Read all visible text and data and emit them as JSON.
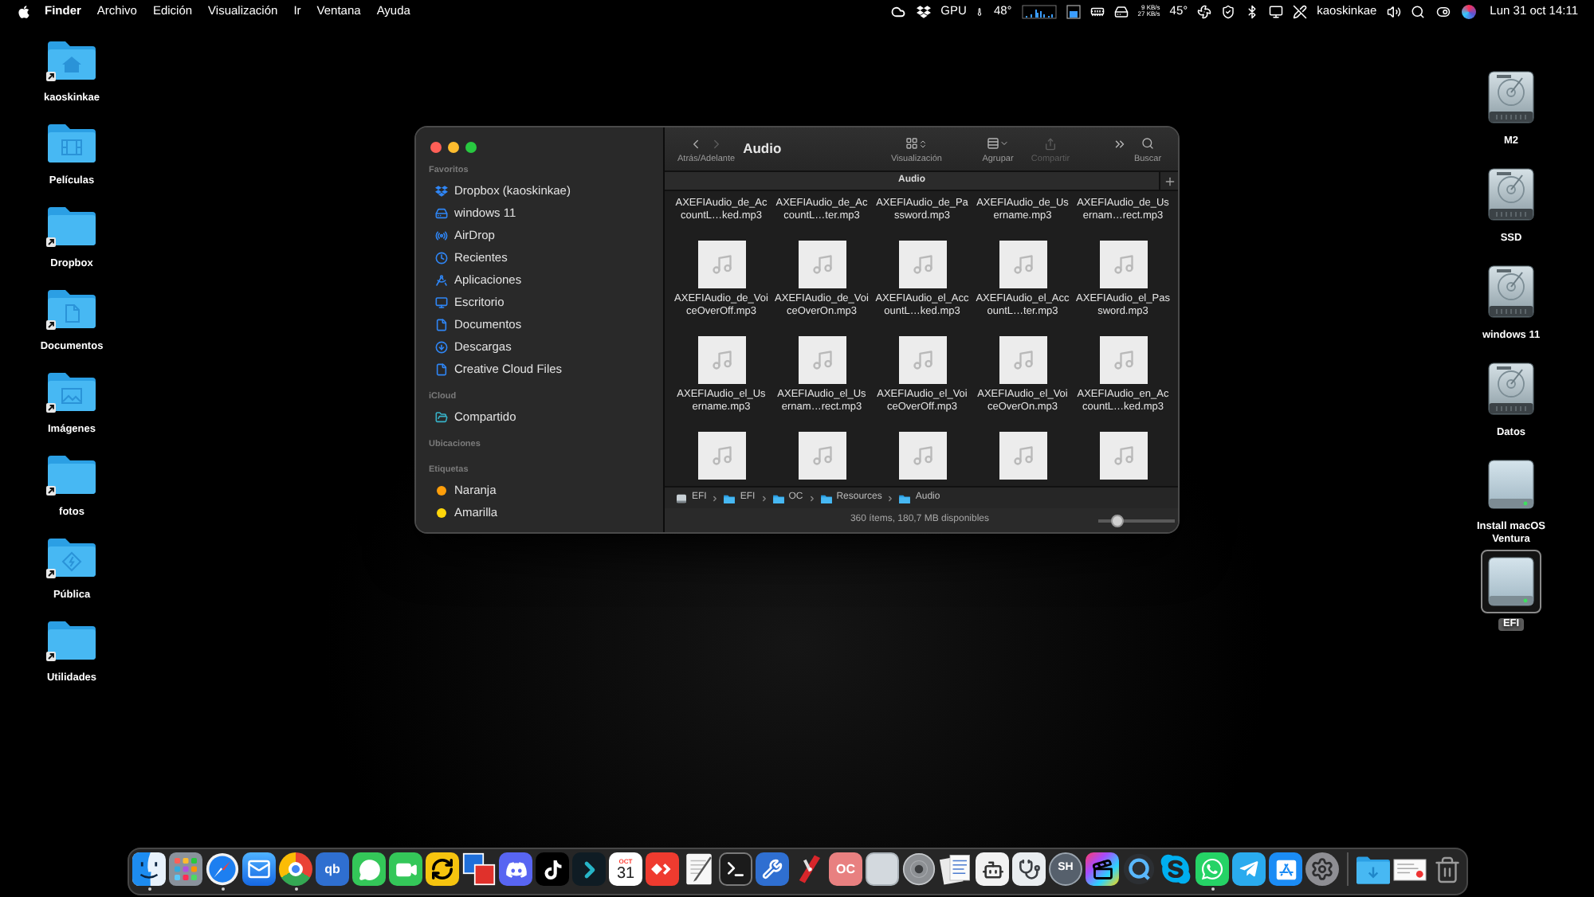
{
  "menu_bar": {
    "app": "Finder",
    "menus": [
      "Archivo",
      "Edición",
      "Visualización",
      "Ir",
      "Ventana",
      "Ayuda"
    ],
    "status": {
      "gpu_label": "GPU",
      "gpu_temp": "48°",
      "net_up": "9 KB/s",
      "net_down": "27 KB/s",
      "cpu_temp": "45°",
      "user": "kaoskinkae",
      "clock": "Lun 31 oct 14:11"
    }
  },
  "desktop_left": [
    {
      "label": "kaoskinkae",
      "kind": "home",
      "alias": true
    },
    {
      "label": "Películas",
      "kind": "film",
      "alias": false
    },
    {
      "label": "Dropbox",
      "kind": "plain",
      "alias": true
    },
    {
      "label": "Documentos",
      "kind": "document",
      "alias": true
    },
    {
      "label": "Imágenes",
      "kind": "image",
      "alias": true
    },
    {
      "label": "fotos",
      "kind": "plain",
      "alias": true
    },
    {
      "label": "Pública",
      "kind": "public",
      "alias": true
    },
    {
      "label": "Utilidades",
      "kind": "plain",
      "alias": true
    }
  ],
  "desktop_right": [
    {
      "label": "M2",
      "kind": "internal",
      "selected": false
    },
    {
      "label": "SSD",
      "kind": "internal",
      "selected": false
    },
    {
      "label": "windows 11",
      "kind": "internal",
      "selected": false
    },
    {
      "label": "Datos",
      "kind": "internal",
      "selected": false
    },
    {
      "label": "Install macOS Ventura",
      "kind": "external",
      "selected": false
    },
    {
      "label": "EFI",
      "kind": "external",
      "selected": true
    }
  ],
  "finder": {
    "sidebar": [
      {
        "title": "Favoritos",
        "items": [
          {
            "label": "Dropbox (kaoskinkae)",
            "kind": "dropbox"
          },
          {
            "label": "windows 11",
            "kind": "drive"
          },
          {
            "label": "AirDrop",
            "kind": "airdrop"
          },
          {
            "label": "Recientes",
            "kind": "recents"
          },
          {
            "label": "Aplicaciones",
            "kind": "apps"
          },
          {
            "label": "Escritorio",
            "kind": "desktop"
          },
          {
            "label": "Documentos",
            "kind": "document"
          },
          {
            "label": "Descargas",
            "kind": "downloads"
          },
          {
            "label": "Creative Cloud Files",
            "kind": "document"
          }
        ]
      },
      {
        "title": "iCloud",
        "items": [
          {
            "label": "Compartido",
            "kind": "shared"
          }
        ]
      },
      {
        "title": "Ubicaciones"
      },
      {
        "title": "Etiquetas",
        "items": [
          {
            "label": "Naranja",
            "kind": "tag",
            "color": "#ff9f0a"
          },
          {
            "label": "Amarilla",
            "kind": "tag",
            "color": "#ffd60a"
          }
        ]
      }
    ],
    "toolbar": {
      "nav": {
        "label": "Atrás/Adelante",
        "back_disabled": false,
        "forward_disabled": true
      },
      "title": "Audio",
      "buttons": [
        {
          "kind": "view",
          "label": "Visualización",
          "disabled": false
        },
        {
          "kind": "group",
          "label": "Agrupar",
          "disabled": false
        },
        {
          "kind": "share",
          "label": "Compartir",
          "disabled": true
        },
        {
          "kind": "more",
          "disabled": false
        },
        {
          "kind": "search",
          "label": "Buscar",
          "disabled": false
        }
      ]
    },
    "tabs": [
      {
        "label": "Audio",
        "selected": true
      }
    ],
    "files": [
      {
        "name": "AXEFIAudio_de_AccountL…ked.mp3",
        "thumbnail": false
      },
      {
        "name": "AXEFIAudio_de_AccountL…ter.mp3",
        "thumbnail": false
      },
      {
        "name": "AXEFIAudio_de_Password.mp3",
        "thumbnail": false
      },
      {
        "name": "AXEFIAudio_de_Username.mp3",
        "thumbnail": false
      },
      {
        "name": "AXEFIAudio_de_Usernam…rect.mp3",
        "thumbnail": false
      },
      {
        "name": "AXEFIAudio_de_VoiceOverOff.mp3",
        "thumbnail": true
      },
      {
        "name": "AXEFIAudio_de_VoiceOverOn.mp3",
        "thumbnail": true
      },
      {
        "name": "AXEFIAudio_el_AccountL…ked.mp3",
        "thumbnail": true
      },
      {
        "name": "AXEFIAudio_el_AccountL…ter.mp3",
        "thumbnail": true
      },
      {
        "name": "AXEFIAudio_el_Password.mp3",
        "thumbnail": true
      },
      {
        "name": "AXEFIAudio_el_Username.mp3",
        "thumbnail": true
      },
      {
        "name": "AXEFIAudio_el_Usernam…rect.mp3",
        "thumbnail": true
      },
      {
        "name": "AXEFIAudio_el_VoiceOverOff.mp3",
        "thumbnail": true
      },
      {
        "name": "AXEFIAudio_el_VoiceOverOn.mp3",
        "thumbnail": true
      },
      {
        "name": "AXEFIAudio_en_AccountL…ked.mp3",
        "thumbnail": true
      },
      {
        "thumbnail": true
      },
      {
        "thumbnail": true
      },
      {
        "thumbnail": true
      },
      {
        "thumbnail": true
      },
      {
        "thumbnail": true
      }
    ],
    "path": [
      {
        "label": "EFI",
        "kind": "disk"
      },
      {
        "label": "EFI",
        "kind": "folder"
      },
      {
        "label": "OC",
        "kind": "folder"
      },
      {
        "label": "Resources",
        "kind": "folder"
      },
      {
        "label": "Audio",
        "kind": "folder"
      }
    ],
    "status": "360 ítems, 180,7 MB disponibles",
    "icon_size": {
      "level": 0.25
    }
  },
  "dock": {
    "apps": [
      {
        "kind": "face",
        "running": true
      },
      {
        "kind": "app_grid",
        "running": false
      },
      {
        "kind": "compass",
        "running": true
      },
      {
        "kind": "envelope",
        "running": false
      },
      {
        "kind": "tricolor",
        "running": true
      },
      {
        "kind": "letter_tile",
        "label": "qb",
        "color": "#2f6fd0",
        "running": false
      },
      {
        "kind": "chat_bubble",
        "running": false
      },
      {
        "kind": "video_camera",
        "running": false
      },
      {
        "kind": "sync_arrows",
        "running": false
      },
      {
        "kind": "overlapping_squares",
        "running": false
      },
      {
        "kind": "controller",
        "running": false
      },
      {
        "kind": "music_note",
        "running": false
      },
      {
        "kind": "chevron",
        "running": false
      },
      {
        "kind": "calendar",
        "month": "OCT",
        "day": "31",
        "running": false
      },
      {
        "kind": "diamonds",
        "running": false
      },
      {
        "kind": "paper_pen",
        "running": false
      },
      {
        "kind": "terminal",
        "running": false
      },
      {
        "kind": "tools",
        "running": false
      },
      {
        "kind": "knife",
        "running": false
      },
      {
        "kind": "letter_tile",
        "label": "OC",
        "color": "#e88080",
        "running": false
      },
      {
        "kind": "blank_tile",
        "running": false
      },
      {
        "kind": "disc",
        "running": false
      },
      {
        "kind": "documents",
        "running": false
      },
      {
        "kind": "robot",
        "running": false
      },
      {
        "kind": "stethoscope",
        "running": false
      },
      {
        "kind": "letter_circle",
        "label": "SH",
        "color": "#56606c",
        "running": false
      },
      {
        "kind": "clapper",
        "running": false
      },
      {
        "kind": "q_ring",
        "running": false
      },
      {
        "kind": "s_logo",
        "running": false
      },
      {
        "kind": "phone_bubble",
        "running": true
      },
      {
        "kind": "paper_plane",
        "running": false
      },
      {
        "kind": "app_store",
        "running": false
      },
      {
        "kind": "gear",
        "running": false
      }
    ],
    "stacks": [
      {
        "kind": "download_folder"
      },
      {
        "kind": "document_thumb"
      },
      {
        "kind": "trash"
      }
    ]
  }
}
